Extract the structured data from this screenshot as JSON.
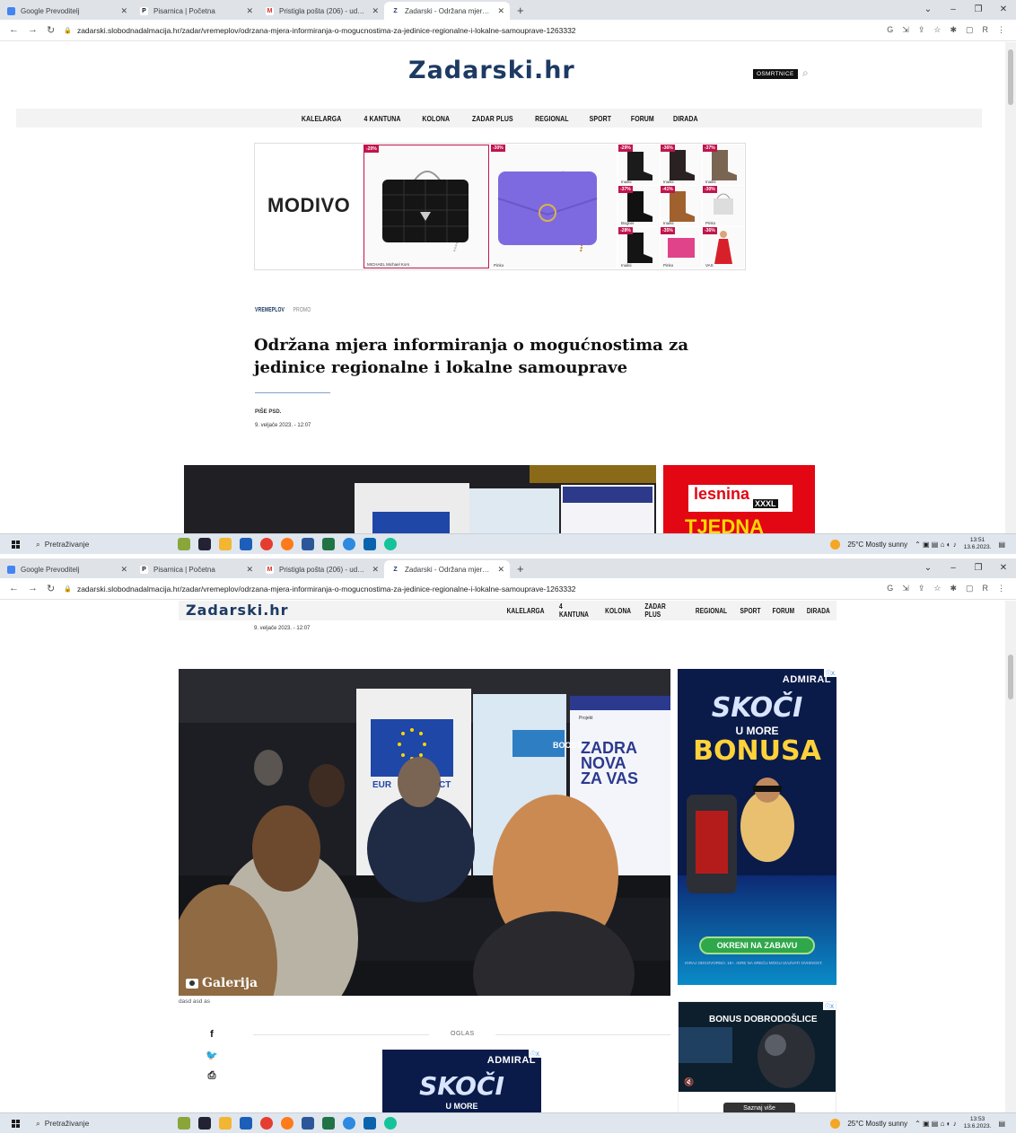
{
  "browser": {
    "tabs": [
      {
        "title": "Google Prevoditelj",
        "icon": "google-translate-icon",
        "color": "#4285f4",
        "glyph": ""
      },
      {
        "title": "Pisarnica | Početna",
        "icon": "pisarnica-icon",
        "color": "#1a1a1a",
        "glyph": "P"
      },
      {
        "title": "Pristigla pošta (206) - udrugazar",
        "icon": "gmail-icon",
        "color": "#d93025",
        "glyph": "M"
      },
      {
        "title": "Zadarski - Održana mjera inform",
        "icon": "zadarski-icon",
        "color": "#1d3a62",
        "glyph": "Z"
      }
    ],
    "new_tab": "+",
    "close": "✕",
    "url": "zadarski.slobodnadalmacija.hr/zadar/vremeplov/odrzana-mjera-informiranja-o-mogucnostima-za-jedinice-regionalne-i-lokalne-samouprave-1263332",
    "ext_g": "G",
    "ext_label": "R"
  },
  "site": {
    "logo": "Zadarski.hr",
    "osmrtnice": "OSMRTNICE",
    "menu": [
      "KALELARGA",
      "4 KANTUNA",
      "KOLONA",
      "ZADAR PLUS",
      "REGIONAL",
      "SPORT",
      "FORUM",
      "DIRADA"
    ]
  },
  "modivo_ad": {
    "brand": "MODIVO",
    "products": [
      {
        "badge": "-20%",
        "caption": "MICHAEL Michael Kors"
      },
      {
        "badge": "-30%",
        "caption": "Pinko"
      },
      {
        "badge": "-29%",
        "caption": "Inuikii"
      },
      {
        "badge": "-36%",
        "caption": "Inuikii"
      },
      {
        "badge": "-37%",
        "caption": "Inuikii"
      },
      {
        "badge": "-37%",
        "caption": "Bogner"
      },
      {
        "badge": "-41%",
        "caption": "Inuikii"
      },
      {
        "badge": "-30%",
        "caption": "Pinko"
      },
      {
        "badge": "-28%",
        "caption": "Inuikii"
      },
      {
        "badge": "-35%",
        "caption": "Pinko"
      },
      {
        "badge": "-36%",
        "caption": "VAS"
      }
    ]
  },
  "article": {
    "category": "VREMEPLOV",
    "tag": "PROMO",
    "title": "Održana mjera informiranja o mogućnostima za jedinice regionalne i lokalne samouprave",
    "author_label": "PIŠE PSD.",
    "date": "9. veljače 2023. - 12:07",
    "gallery_label": "Galerija",
    "photo_caption": "dasd asd as",
    "oglas": "OGLAS",
    "photo_texts": {
      "boosts": "BOOSTS",
      "zadra": "ZADRA",
      "nova": "NOVA",
      "zavas": "ZA VAS",
      "euro": "EUR",
      "ct": "CT",
      "projekt": "Projekt"
    }
  },
  "ads": {
    "lesnina": {
      "brand": "lesnina",
      "xxxl": "XXXL",
      "tjedna": "TJEDNA"
    },
    "admiral": {
      "brand": "ADMIRAL",
      "line1": "SKOČI",
      "line2": "U MORE",
      "line3": "BONUSA",
      "button": "OKRENI NA ZABAVU",
      "legal": "IGRAJ ODGOVORNO. 18+. IGRE NA SREĆU MOGU IZAZVATI OVISNOST."
    },
    "bonus_video": {
      "title": "BONUS DOBRODOŠLICE",
      "button": "Saznaj više"
    },
    "adchoices": "ⓘX"
  },
  "taskbar": {
    "search": "Pretraživanje",
    "weather": "25°C  Mostly sunny",
    "time1": "13:51",
    "time2": "13:53",
    "date": "13.6.2023."
  },
  "colors": {
    "brand_blue": "#1d3a62",
    "admiral_green": "#2ea84a",
    "lesnina_red": "#e30613"
  }
}
